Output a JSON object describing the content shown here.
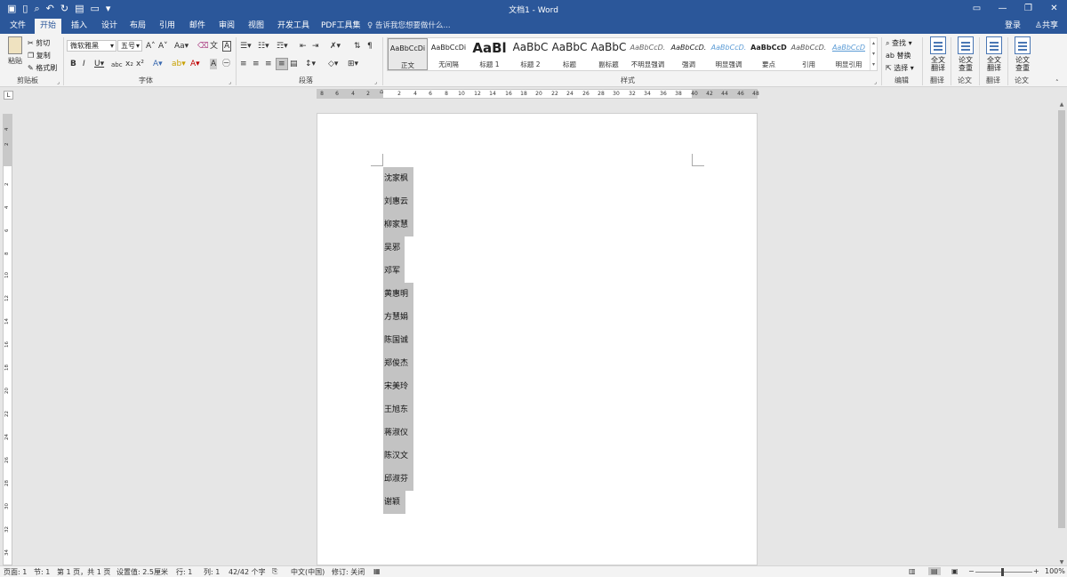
{
  "window": {
    "title": "文档1 - Word",
    "quick_access_icons": [
      "save-icon",
      "new-document-icon",
      "print-preview-icon",
      "undo-icon",
      "redo-icon",
      "form-icon",
      "open-folder-icon",
      "customize-qat-icon"
    ]
  },
  "tabs": [
    "文件",
    "开始",
    "插入",
    "设计",
    "布局",
    "引用",
    "邮件",
    "审阅",
    "视图",
    "开发工具",
    "PDF工具集"
  ],
  "active_tab": "开始",
  "tell_me": "告诉我您想要做什么...",
  "account": {
    "login": "登录",
    "share": "共享"
  },
  "clipboard": {
    "paste": "粘贴",
    "cut": "剪切",
    "copy": "复制",
    "format_painter": "格式刷",
    "label": "剪贴板"
  },
  "font": {
    "name": "微软雅黑",
    "size": "五号",
    "label": "字体"
  },
  "paragraph": {
    "label": "段落"
  },
  "styles": {
    "label": "样式",
    "items": [
      {
        "sample": "AaBbCcDi",
        "name": "正文"
      },
      {
        "sample": "AaBbCcDi",
        "name": "无间隔"
      },
      {
        "sample": "AaBl",
        "name": "标题 1"
      },
      {
        "sample": "AaBbC",
        "name": "标题 2"
      },
      {
        "sample": "AaBbC",
        "name": "标题"
      },
      {
        "sample": "AaBbC",
        "name": "副标题"
      },
      {
        "sample": "AaBbCcD.",
        "name": "不明显强调"
      },
      {
        "sample": "AaBbCcD.",
        "name": "强调"
      },
      {
        "sample": "AaBbCcD.",
        "name": "明显强调"
      },
      {
        "sample": "AaBbCcD",
        "name": "要点"
      },
      {
        "sample": "AaBbCcD.",
        "name": "引用"
      },
      {
        "sample": "AaBbCcD",
        "name": "明显引用"
      }
    ]
  },
  "editing": {
    "find": "查找",
    "replace": "替换",
    "select": "选择",
    "label": "编辑"
  },
  "translate1": {
    "line1": "全文",
    "line2": "翻译",
    "label": "翻译"
  },
  "paper1": {
    "line1": "论文",
    "line2": "查重",
    "label": "论文"
  },
  "translate2": {
    "line1": "全文",
    "line2": "翻译",
    "label": "翻译"
  },
  "paper2": {
    "line1": "论文",
    "line2": "查重",
    "label": "论文"
  },
  "ruler_ticks": [
    "8",
    "6",
    "4",
    "2",
    "2",
    "4",
    "6",
    "8",
    "10",
    "12",
    "14",
    "16",
    "18",
    "20",
    "22",
    "24",
    "26",
    "28",
    "30",
    "32",
    "34",
    "36",
    "38",
    "40",
    "42",
    "44",
    "46",
    "48"
  ],
  "vruler_ticks": [
    "4",
    "2",
    "2",
    "4",
    "6",
    "8",
    "10",
    "12",
    "14",
    "16",
    "18",
    "20",
    "22",
    "24",
    "26",
    "28",
    "30",
    "32",
    "34"
  ],
  "document": {
    "names": [
      "沈家枫",
      "刘惠云",
      "柳家慧",
      "吴邪",
      "邓军",
      "黄惠明",
      "方慧娟",
      "陈国诚",
      "郑俊杰",
      "宋美玲",
      "王旭东",
      "蒋淑仪",
      "陈汉文",
      "邱淑芬",
      "谢颖"
    ]
  },
  "status": {
    "page": "页面: 1",
    "section": "节: 1",
    "page_of": "第 1 页，共 1 页",
    "setting": "设置值: 2.5厘米",
    "line": "行: 1",
    "column": "列: 1",
    "words": "42/42 个字",
    "language": "中文(中国)",
    "track": "修订: 关闭",
    "zoom": "100%"
  }
}
